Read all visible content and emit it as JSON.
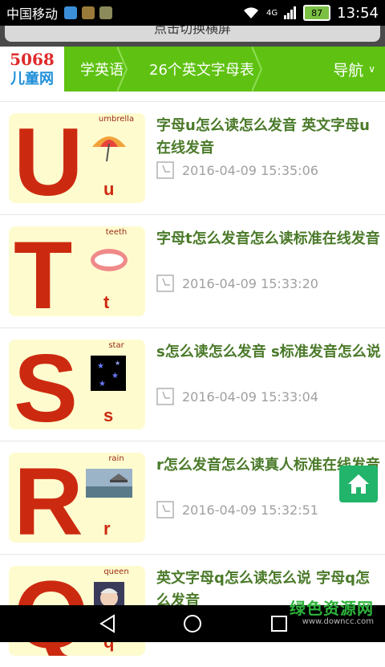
{
  "status_bar": {
    "carrier": "中国移动",
    "network": "4G",
    "battery": "87",
    "time": "13:54"
  },
  "banner": {
    "text": "点击切换横屏"
  },
  "navbar": {
    "logo_top": "5068",
    "logo_bottom": "儿童网",
    "crumbs": [
      "学英语",
      "26个英文字母表"
    ],
    "menu_label": "导航"
  },
  "articles": [
    {
      "letter_upper": "U",
      "letter_lower": "u",
      "word": "umbrella",
      "title": "字母u怎么读怎么发音 英文字母u在线发音",
      "date": "2016-04-09 15:35:06"
    },
    {
      "letter_upper": "T",
      "letter_lower": "t",
      "word": "teeth",
      "title": "字母t怎么发音怎么读标准在线发音",
      "date": "2016-04-09 15:33:20"
    },
    {
      "letter_upper": "S",
      "letter_lower": "s",
      "word": "star",
      "title": "s怎么读怎么发音 s标准发音怎么说",
      "date": "2016-04-09 15:33:04"
    },
    {
      "letter_upper": "R",
      "letter_lower": "r",
      "word": "rain",
      "title": "r怎么发音怎么读真人标准在线发音",
      "date": "2016-04-09 15:32:51"
    },
    {
      "letter_upper": "Q",
      "letter_lower": "q",
      "word": "queen",
      "title": "英文字母q怎么读怎么说 字母q怎么发音",
      "date": ""
    }
  ],
  "watermark": {
    "text": "绿色资源网",
    "url": "www.downcc.com"
  },
  "colors": {
    "nav_green": "#5fc212",
    "title_green": "#4b7a2a",
    "letter_red": "#cc2a10",
    "fab_green": "#21b46a"
  }
}
